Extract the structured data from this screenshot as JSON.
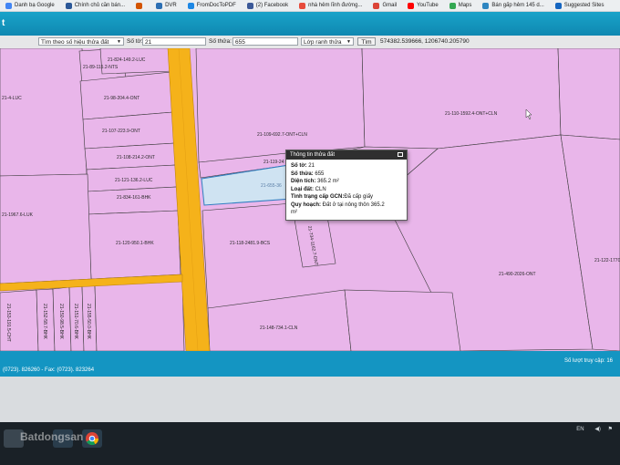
{
  "bookmarks": [
    {
      "label": "Danh bạ Google",
      "color": "#4285f4",
      "icon": "contacts-icon"
    },
    {
      "label": "Chính chủ cần bán...",
      "color": "#2b5797",
      "icon": "bookmark-icon"
    },
    {
      "label": "",
      "color": "#d35400",
      "icon": "music-icon"
    },
    {
      "label": "DVR",
      "color": "#2c6fb3",
      "icon": "globe-icon"
    },
    {
      "label": "FromDocToPDF",
      "color": "#1e88e5",
      "icon": "pdf-icon"
    },
    {
      "label": "(2) Facebook",
      "color": "#3b5998",
      "icon": "facebook-icon"
    },
    {
      "label": "nhà hẻm lĩnh đường...",
      "color": "#e74c3c",
      "icon": "bookmark-icon"
    },
    {
      "label": "Gmail",
      "color": "#db4437",
      "icon": "gmail-icon"
    },
    {
      "label": "YouTube",
      "color": "#ff0000",
      "icon": "youtube-icon"
    },
    {
      "label": "Maps",
      "color": "#34a853",
      "icon": "maps-icon"
    },
    {
      "label": "Bán gấp hẻm 145 d...",
      "color": "#2e86c1",
      "icon": "bookmark-icon"
    },
    {
      "label": "Suggested Sites",
      "color": "#1565c0",
      "icon": "ie-icon"
    }
  ],
  "app": {
    "title": "t"
  },
  "search": {
    "mode_label": "Tìm theo số hiệu thửa đất",
    "so_to_label": "Số tờ:",
    "so_to_value": "21",
    "so_thua_label": "Số thửa:",
    "so_thua_value": "655",
    "layer_select": "Lớp ranh thửa",
    "search_button": "Tìm",
    "coords": "574382.539666, 1206740.205790"
  },
  "parcels": [
    {
      "label": "21-824-149.2-LUC"
    },
    {
      "label": "21-89-115.2-NTS"
    },
    {
      "label": "21-4-LUC"
    },
    {
      "label": "21-98-204.4-ONT"
    },
    {
      "label": "21-107-223.9-ONT"
    },
    {
      "label": "21-108-214.2-ONT"
    },
    {
      "label": "21-121-136.2-LUC"
    },
    {
      "label": "21-834-161-BHK"
    },
    {
      "label": "21-120-950.1-BHK"
    },
    {
      "label": "21-109-692.7-ONT+CLN"
    },
    {
      "label": "21-119-24"
    },
    {
      "label": "21-655-36"
    },
    {
      "label": "21-110-1592.4-ONT+CLN"
    },
    {
      "label": "21-118-2481.9-BCS"
    },
    {
      "label": "21-734-1162.7-DNT"
    },
    {
      "label": "21-490-2026-ONT"
    },
    {
      "label": "21-122-1770"
    },
    {
      "label": "21-148-734.1-CLN"
    },
    {
      "label": "21-1967.6-LUK"
    },
    {
      "label": "21-153-191.5-CHT"
    },
    {
      "label": "21-152-58.7-BHK"
    },
    {
      "label": "21-150-98.5-BHK"
    },
    {
      "label": "21-151-70.6-BHK"
    },
    {
      "label": "21-155-50.0-BHK"
    }
  ],
  "popup": {
    "title": "Thông tin thửa đất",
    "rows": [
      {
        "key": "Số tờ:",
        "value": " 21"
      },
      {
        "key": "Số thửa:",
        "value": " 655"
      },
      {
        "key": "Diện tích:",
        "value": " 365.2 m²"
      },
      {
        "key": "Loại đất:",
        "value": " CLN"
      },
      {
        "key": "Tình trạng cấp GCN:",
        "value": "Đã cấp giấy"
      },
      {
        "key": "Quy hoạch:",
        "value": " Đất ở tại nông thôn 365.2"
      }
    ],
    "wrap": "m²"
  },
  "footer": {
    "contact": "(0723). 826260 - Fax: (0723). 823264",
    "visits": "Số lượt truy cập: 16"
  },
  "tray": {
    "lang": "EN"
  },
  "watermark": "Batdongsan",
  "colors": {
    "map_bg": "#e9b6ea",
    "road": "#f5b21a",
    "header": "#1495c2",
    "selected_parcel": "#cfe3f2"
  }
}
